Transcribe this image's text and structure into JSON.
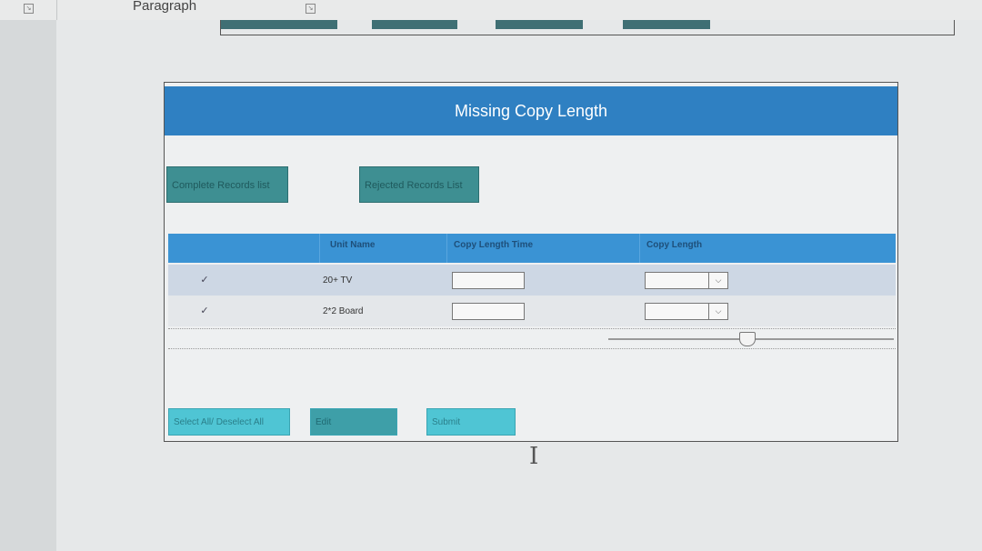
{
  "ribbon": {
    "group_label": "Paragraph"
  },
  "panel": {
    "title": "Missing Copy Length",
    "nav_buttons": [
      "Complete Records list",
      "Rejected Records List"
    ],
    "columns": [
      "Unit Name",
      "Copy Length Time",
      "Copy Length"
    ],
    "rows": [
      {
        "checked": "✓",
        "unit": "20+ TV",
        "time": "",
        "length": ""
      },
      {
        "checked": "✓",
        "unit": "2*2 Board",
        "time": "",
        "length": ""
      }
    ],
    "action_buttons": [
      "Select All/ Deselect All",
      "Edit",
      "Submit"
    ]
  },
  "icons": {
    "check": "check-icon",
    "caret": "chevron-down-icon",
    "cursor": "text-cursor-icon"
  }
}
